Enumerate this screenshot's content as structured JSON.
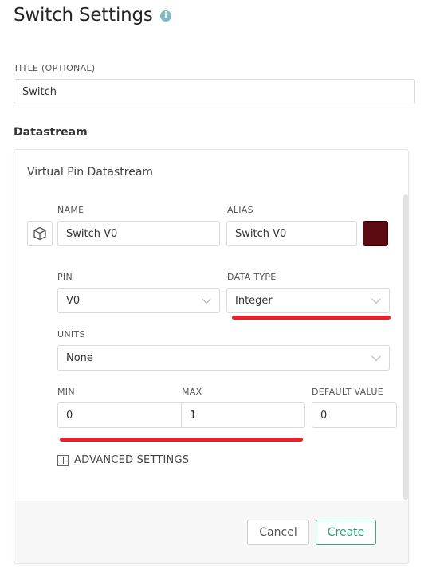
{
  "header": {
    "title": "Switch Settings",
    "info_icon": "i"
  },
  "title_field": {
    "label": "TITLE (OPTIONAL)",
    "value": "Switch"
  },
  "datastream": {
    "section_label": "Datastream",
    "card_title": "Virtual Pin Datastream",
    "name": {
      "label": "NAME",
      "value": "Switch V0"
    },
    "alias": {
      "label": "ALIAS",
      "value": "Switch V0"
    },
    "color": "#5b0a10",
    "pin": {
      "label": "PIN",
      "value": "V0"
    },
    "data_type": {
      "label": "DATA TYPE",
      "value": "Integer"
    },
    "units": {
      "label": "UNITS",
      "value": "None"
    },
    "min": {
      "label": "MIN",
      "value": "0"
    },
    "max": {
      "label": "MAX",
      "value": "1"
    },
    "default_value": {
      "label": "DEFAULT VALUE",
      "value": "0"
    },
    "advanced_settings": "ADVANCED SETTINGS",
    "annotation_color": "#e8202a"
  },
  "footer": {
    "cancel": "Cancel",
    "create": "Create"
  }
}
